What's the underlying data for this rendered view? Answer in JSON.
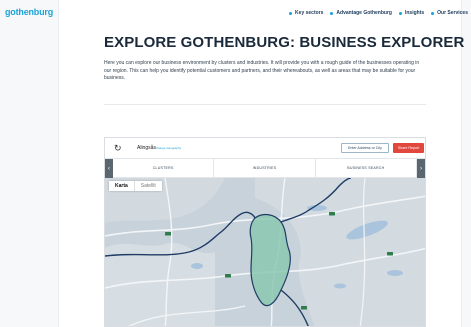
{
  "header": {
    "logo": "gothenburg",
    "nav": [
      {
        "label": "Key sectors"
      },
      {
        "label": "Advantage Gothenburg"
      },
      {
        "label": "Insights"
      },
      {
        "label": "Our Services"
      }
    ]
  },
  "main": {
    "title": "EXPLORE GOTHENBURG: BUSINESS EXPLORER",
    "intro": "Here you can explore our business environment by clusters and industries. It will provide you with a rough guide of the businesses operating in our region. This can help you identify potential customers and partners, and their whereabouts, as well as areas that may be suitable for your business."
  },
  "widget": {
    "refresh_icon": "refresh-icon",
    "location": "Alingsås",
    "location_link": "Change Geography",
    "enter_button": "Enter Address or City",
    "share_button": "Share Report",
    "tabs": [
      "CLUSTERS",
      "INDUSTRIES",
      "BUSINESS SEARCH"
    ],
    "map_types": {
      "active": "Karta",
      "inactive": "Satellit"
    },
    "colors": {
      "accent": "#1aa3d9",
      "share": "#e2473e",
      "region_fill": "#8cc8b0",
      "boundary": "#1f3c66"
    }
  }
}
